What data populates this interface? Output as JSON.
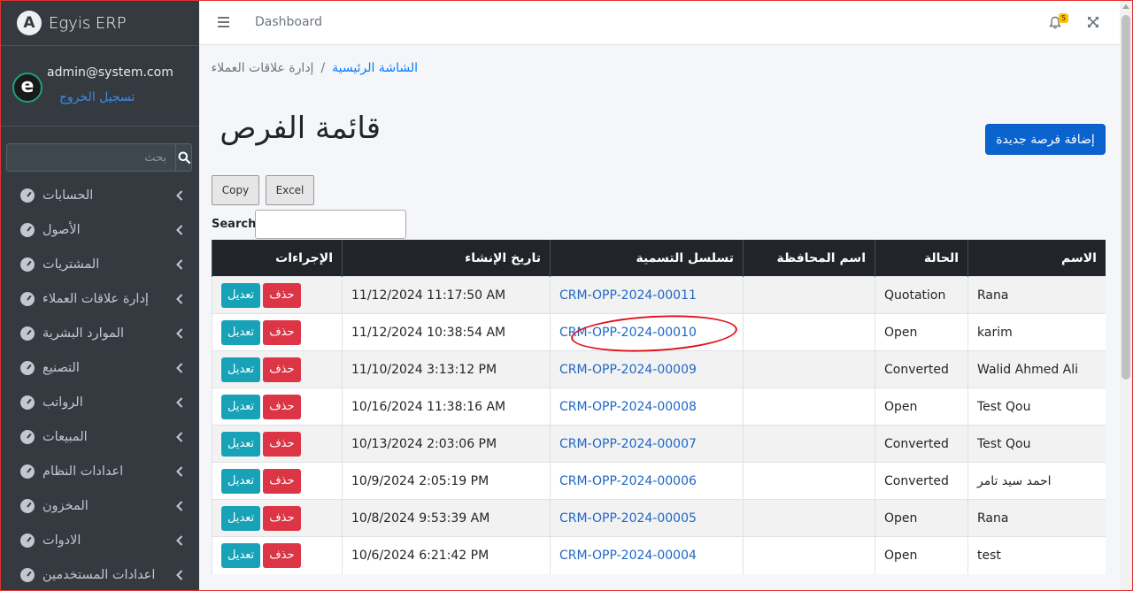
{
  "app": {
    "name": "Egyis ERP",
    "logo_letter": "A"
  },
  "user": {
    "avatar_letter": "e",
    "email": "admin@system.com",
    "logout": "تسجيل الخروج"
  },
  "sidebar": {
    "search_placeholder": "بحث",
    "items": [
      {
        "label": "الحسابات"
      },
      {
        "label": "الأصول"
      },
      {
        "label": "المشتريات"
      },
      {
        "label": "إدارة علاقات العملاء"
      },
      {
        "label": "الموارد البشرية"
      },
      {
        "label": "التصنيع"
      },
      {
        "label": "الرواتب"
      },
      {
        "label": "المبيعات"
      },
      {
        "label": "اعدادات النظام"
      },
      {
        "label": "المخزون"
      },
      {
        "label": "الادوات"
      },
      {
        "label": "اعدادات المستخدمين"
      }
    ]
  },
  "topbar": {
    "title": "Dashboard",
    "notification_count": "5"
  },
  "breadcrumb": {
    "home": "الشاشة الرئيسية",
    "separator": "/",
    "current": "إدارة علاقات العملاء"
  },
  "page": {
    "title": "قائمة الفرص",
    "add_button": "إضافة فرصة جديدة"
  },
  "datatable": {
    "copy": "Copy",
    "excel": "Excel",
    "search_label": "Search:"
  },
  "table": {
    "headers": {
      "name": "الاسم",
      "status": "الحالة",
      "governorate": "اسم المحافظة",
      "naming_series": "تسلسل التسمية",
      "created": "تاريخ الإنشاء",
      "actions": "الإجراءات"
    },
    "edit_label": "تعديل",
    "delete_label": "حذف",
    "rows": [
      {
        "name": "Rana",
        "status": "Quotation",
        "governorate": "",
        "code": "CRM-OPP-2024-00011",
        "created": "11/12/2024 11:17:50 AM"
      },
      {
        "name": "karim",
        "status": "Open",
        "governorate": "",
        "code": "CRM-OPP-2024-00010",
        "created": "11/12/2024 10:38:54 AM"
      },
      {
        "name": "Walid Ahmed Ali",
        "status": "Converted",
        "governorate": "",
        "code": "CRM-OPP-2024-00009",
        "created": "11/10/2024 3:13:12 PM"
      },
      {
        "name": "Test Qou",
        "status": "Open",
        "governorate": "",
        "code": "CRM-OPP-2024-00008",
        "created": "10/16/2024 11:38:16 AM"
      },
      {
        "name": "Test Qou",
        "status": "Converted",
        "governorate": "",
        "code": "CRM-OPP-2024-00007",
        "created": "10/13/2024 2:03:06 PM"
      },
      {
        "name": "احمد سيد تامر",
        "status": "Converted",
        "governorate": "",
        "code": "CRM-OPP-2024-00006",
        "created": "10/9/2024 2:05:19 PM"
      },
      {
        "name": "Rana",
        "status": "Open",
        "governorate": "",
        "code": "CRM-OPP-2024-00005",
        "created": "10/8/2024 9:53:39 AM"
      },
      {
        "name": "test",
        "status": "Open",
        "governorate": "",
        "code": "CRM-OPP-2024-00004",
        "created": "10/6/2024 6:21:42 PM"
      }
    ]
  },
  "colors": {
    "sidebar_bg": "#343a40",
    "primary": "#0b63ce",
    "danger": "#dc3545",
    "info": "#17a2b8",
    "annotation": "#e0101a"
  }
}
